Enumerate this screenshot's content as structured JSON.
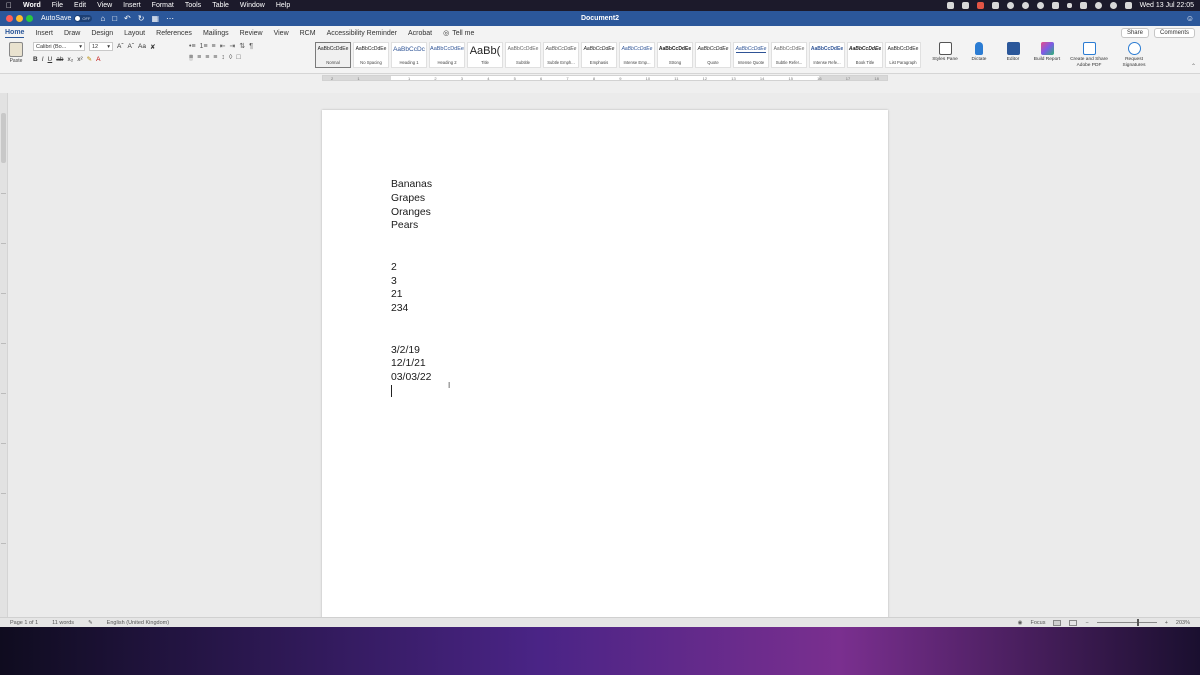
{
  "menubar": {
    "app_name": "Word",
    "menus": [
      "File",
      "Edit",
      "View",
      "Insert",
      "Format",
      "Tools",
      "Table",
      "Window",
      "Help"
    ],
    "clock": "Wed 13 Jul  22:05"
  },
  "titlebar": {
    "autosave_label": "AutoSave",
    "autosave_state": "OFF",
    "document_title": "Document2"
  },
  "ribbon": {
    "tabs": [
      "Home",
      "Insert",
      "Draw",
      "Design",
      "Layout",
      "References",
      "Mailings",
      "Review",
      "View",
      "RCM",
      "Accessibility Reminder",
      "Acrobat"
    ],
    "tell_me": "Tell me",
    "share_label": "Share",
    "comments_label": "Comments",
    "paste_label": "Paste",
    "font_name": "Calibri (Bo...",
    "font_size": "12",
    "styles": [
      {
        "sample": "AaBbCcDdEe",
        "name": "Normal"
      },
      {
        "sample": "AaBbCcDdEe",
        "name": "No Spacing"
      },
      {
        "sample": "AaBbCcDc",
        "name": "Heading 1"
      },
      {
        "sample": "AaBbCcDdEe",
        "name": "Heading 2"
      },
      {
        "sample": "AaBb(",
        "name": "Title"
      },
      {
        "sample": "AaBbCcDdEe",
        "name": "Subtitle"
      },
      {
        "sample": "AaBbCcDdEe",
        "name": "Subtle Emph..."
      },
      {
        "sample": "AaBbCcDdEe",
        "name": "Emphasis"
      },
      {
        "sample": "AaBbCcDdEe",
        "name": "Intense Emp..."
      },
      {
        "sample": "AaBbCcDdEe",
        "name": "Strong"
      },
      {
        "sample": "AaBbCcDdEe",
        "name": "Quote"
      },
      {
        "sample": "AaBbCcDdEe",
        "name": "Intense Quote"
      },
      {
        "sample": "AaBbCcDdEe",
        "name": "Subtle Refer..."
      },
      {
        "sample": "AaBbCcDdEe",
        "name": "Intense Refe..."
      },
      {
        "sample": "AaBbCcDdEe",
        "name": "Book Title"
      },
      {
        "sample": "AaBbCcDdEe",
        "name": "List Paragraph"
      }
    ],
    "tools": {
      "styles_pane": "Styles Pane",
      "dictate": "Dictate",
      "editor": "Editor",
      "build_report": "Build Report",
      "create_share_pdf": "Create and Share Adobe PDF",
      "request_signatures": "Request Signatures"
    }
  },
  "ruler": {
    "ticks": [
      "2",
      "1",
      "",
      "1",
      "2",
      "3",
      "4",
      "5",
      "6",
      "7",
      "8",
      "9",
      "10",
      "11",
      "12",
      "13",
      "14",
      "15",
      "16",
      "17",
      "18"
    ]
  },
  "document": {
    "paragraphs": [
      "Bananas",
      "Grapes",
      "Oranges",
      "Pears",
      "",
      "",
      "2",
      "3",
      "21",
      "234",
      "",
      "",
      "3/2/19",
      "12/1/21",
      "03/03/22"
    ]
  },
  "statusbar": {
    "page": "Page 1 of 1",
    "words": "11 words",
    "language": "English (United Kingdom)",
    "focus": "Focus",
    "zoom": "203%"
  },
  "colors": {
    "accent": "#2b579a"
  }
}
